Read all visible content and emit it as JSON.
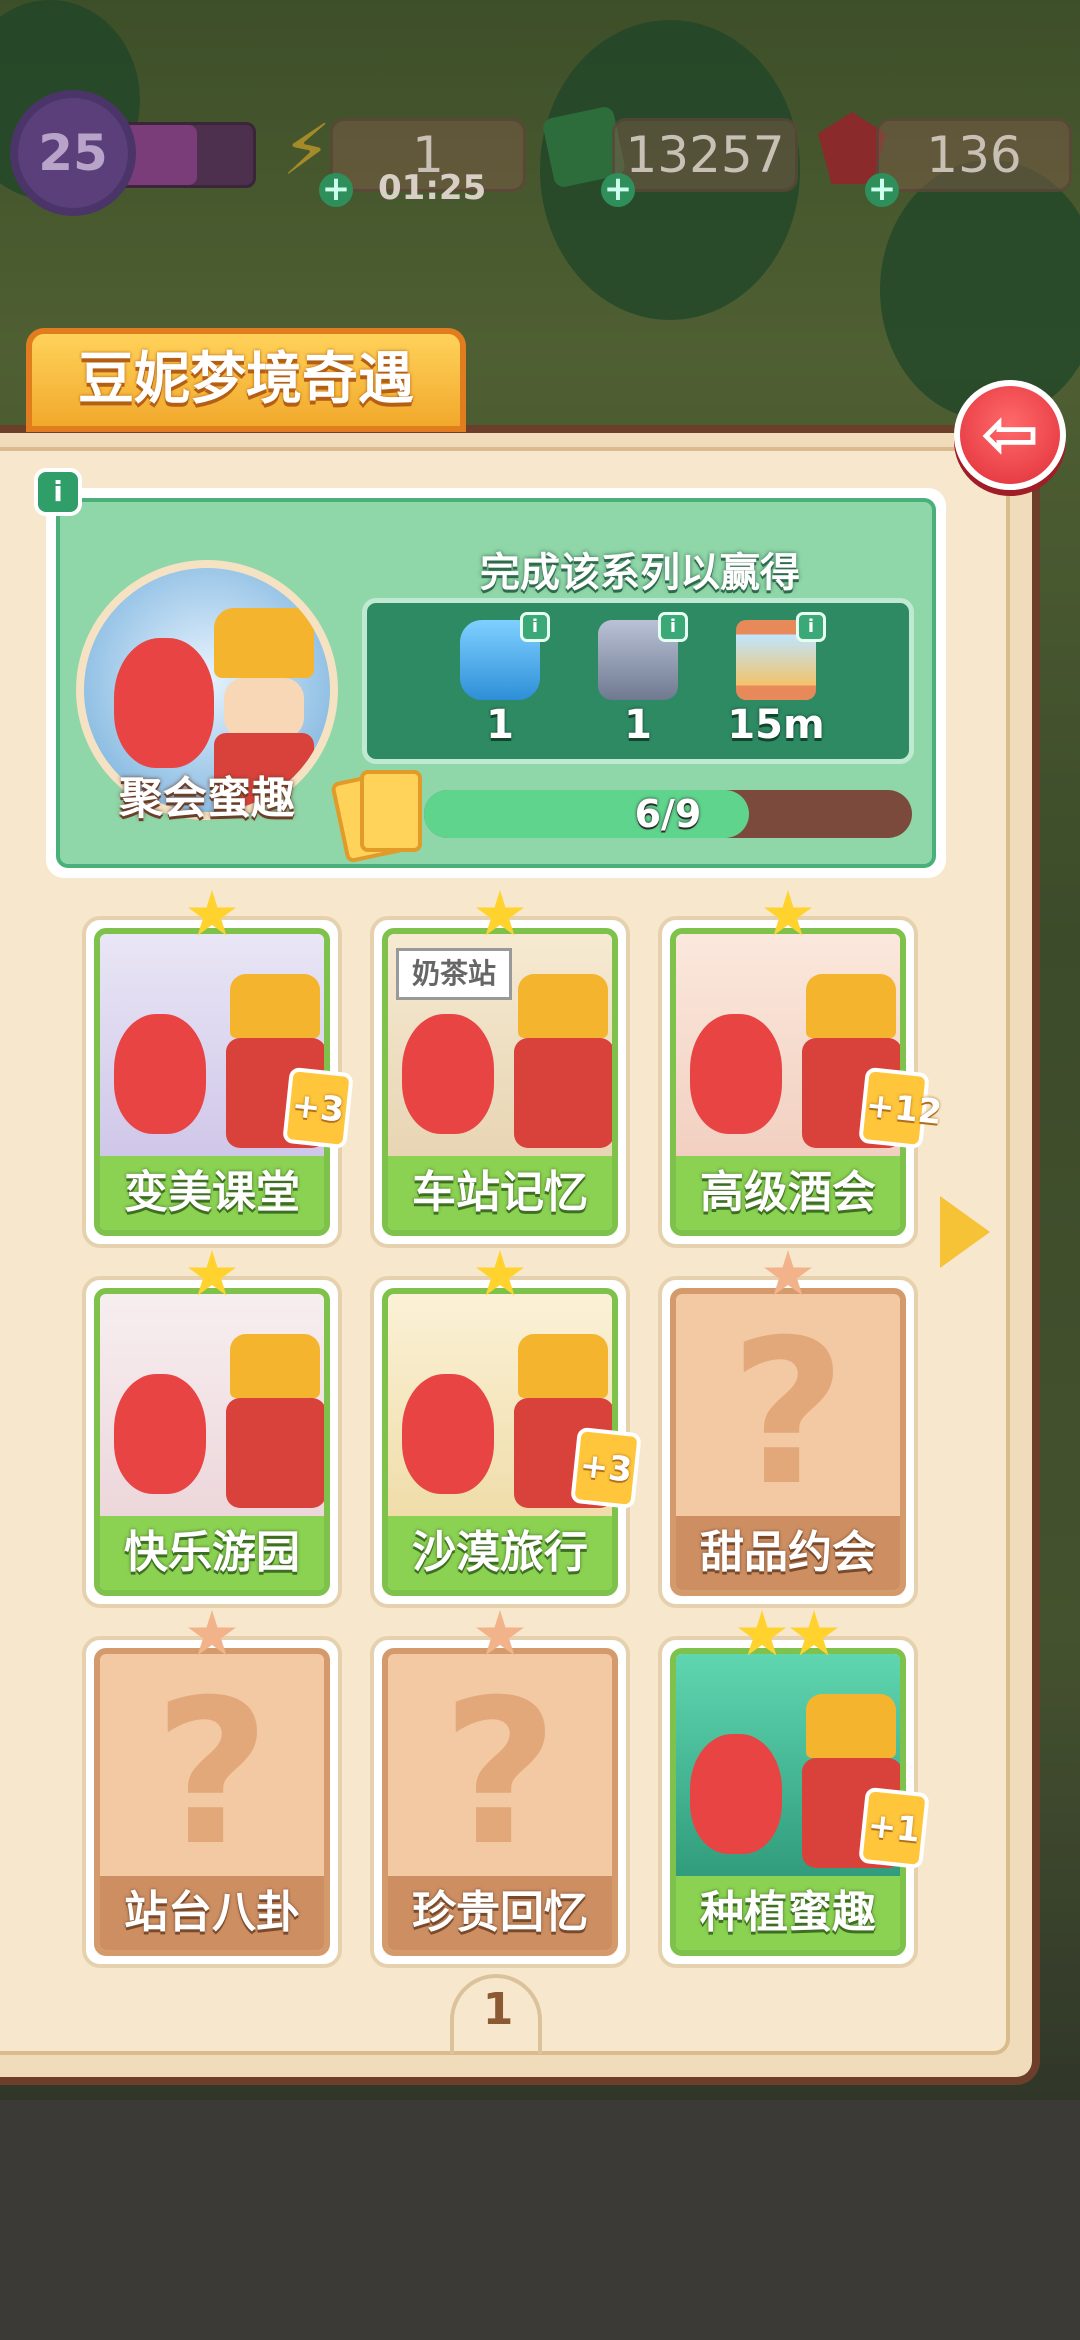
{
  "hud": {
    "level": "25",
    "level_progress": 0.6,
    "energy": "1",
    "energy_timer": "01:25",
    "cash": "13257",
    "gems": "136"
  },
  "title": "豆妮梦境奇遇",
  "collection": {
    "name": "聚会蜜趣",
    "rewards_title": "完成该系列以赢得",
    "rewards": [
      {
        "icon": "energy-jar-icon",
        "qty": "1"
      },
      {
        "icon": "cash-safe-icon",
        "qty": "1"
      },
      {
        "icon": "hourglass-icon",
        "qty": "15m"
      }
    ],
    "progress_text": "6/9",
    "progress_fraction": 0.667
  },
  "cards": [
    {
      "name": "变美课堂",
      "stars": 1,
      "locked": false,
      "badge": "+3"
    },
    {
      "name": "车站记忆",
      "stars": 1,
      "locked": false,
      "badge": "",
      "sign": "奶茶站"
    },
    {
      "name": "高级酒会",
      "stars": 1,
      "locked": false,
      "badge": "+12"
    },
    {
      "name": "快乐游园",
      "stars": 1,
      "locked": false,
      "badge": ""
    },
    {
      "name": "沙漠旅行",
      "stars": 1,
      "locked": false,
      "badge": "+3"
    },
    {
      "name": "甜品约会",
      "stars": 1,
      "locked": true,
      "badge": ""
    },
    {
      "name": "站台八卦",
      "stars": 1,
      "locked": true,
      "badge": ""
    },
    {
      "name": "珍贵回忆",
      "stars": 1,
      "locked": true,
      "badge": ""
    },
    {
      "name": "种植蜜趣",
      "stars": 2,
      "locked": false,
      "badge": "+1"
    }
  ],
  "page_number": "1",
  "info_label": "i",
  "qmark": "?",
  "back_glyph": "⇦",
  "plus_glyph": "+",
  "energy_glyph": "⚡"
}
